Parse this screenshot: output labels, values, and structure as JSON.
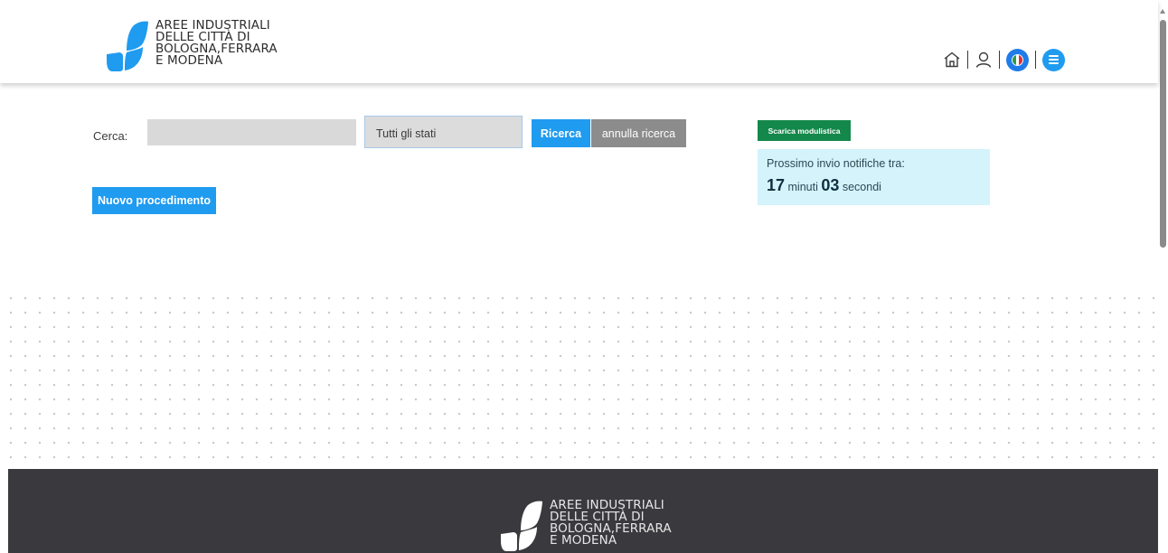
{
  "header": {
    "logo_lines": [
      "AREE INDUSTRIALI",
      "DELLE CITTÀ DI",
      "BOLOGNA,FERRARA",
      "E MODENA"
    ],
    "icons": [
      "home-icon",
      "user-icon",
      "language-flag-icon",
      "menu-icon"
    ],
    "flag_colors": [
      "#2c9d45",
      "#ffffff",
      "#e03030"
    ]
  },
  "search": {
    "label": "Cerca:",
    "input_value": "",
    "status_selected": "Tutti gli stati",
    "search_button": "Ricerca",
    "cancel_button": "annulla ricerca"
  },
  "actions": {
    "new_procedure_button": "Nuovo procedimento"
  },
  "side_panel": {
    "download_button": "Scarica modulistica",
    "notification_title": "Prossimo invio notifiche tra:",
    "minutes": "17",
    "minutes_label": "minuti",
    "seconds": "03",
    "seconds_label": "secondi"
  },
  "footer": {
    "logo_lines": [
      "AREE INDUSTRIALI",
      "DELLE CITTÀ DI",
      "BOLOGNA,FERRARA",
      "E MODENA"
    ]
  },
  "colors": {
    "primary_blue": "#1f9bf0",
    "green": "#14884a",
    "grey_button": "#8c8c8c",
    "notification_bg": "#d4f3fb",
    "footer_bg": "#3a393e"
  }
}
